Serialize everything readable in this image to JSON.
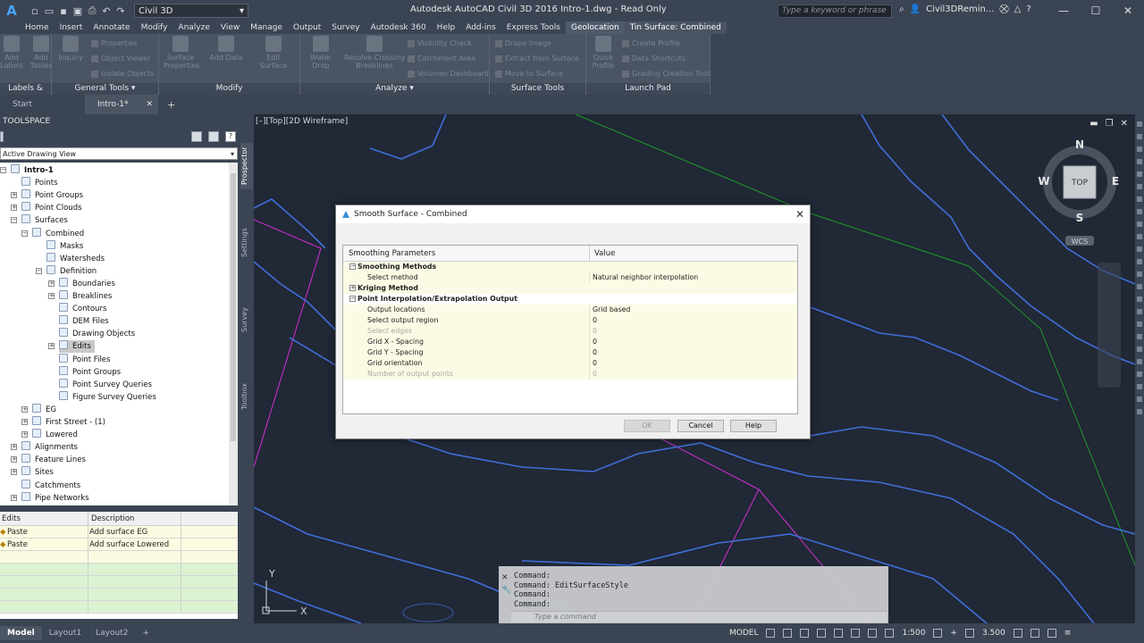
{
  "titlebar": {
    "app_logo": "A",
    "workspace": "Civil 3D",
    "title": "Autodesk AutoCAD Civil 3D 2016    Intro-1.dwg - Read Only",
    "search_placeholder": "Type a keyword or phrase",
    "user": "Civil3DRemin..."
  },
  "ribbon_tabs": [
    "Home",
    "Insert",
    "Annotate",
    "Modify",
    "Analyze",
    "View",
    "Manage",
    "Output",
    "Survey",
    "Autodesk 360",
    "Help",
    "Add-ins",
    "Express Tools",
    "Geolocation",
    "Tin Surface: Combined"
  ],
  "ribbon_groups": {
    "labels_tables": "Labels & Tables",
    "general_tools": "General Tools",
    "modify": "Modify",
    "analyze": "Analyze",
    "surface_tools": "Surface Tools",
    "launch_pad": "Launch Pad",
    "buttons": {
      "add_labels": "Add Labels",
      "add_tables": "Add Tables",
      "inquiry": "Inquiry",
      "properties": "Properties",
      "object_viewer": "Object Viewer",
      "isolate_objects": "Isolate Objects",
      "surface_properties": "Surface Properties",
      "add_data": "Add Data",
      "edit_surface": "Edit Surface",
      "water_drop": "Water Drop",
      "resolve_crossing": "Resolve Crossing Breaklines",
      "visibility_check": "Visibility Check",
      "catchment_area": "Catchment Area",
      "volumes_dashboard": "Volumes Dashboard",
      "drape_image": "Drape Image",
      "extract_from_surface": "Extract from Surface",
      "move_to_surface": "Move to Surface",
      "quick_profile": "Quick Profile",
      "create_profile": "Create Profile",
      "data_shortcuts": "Data Shortcuts",
      "grading_creation_tools": "Grading Creation Tools"
    }
  },
  "doc_tabs": {
    "start": "Start",
    "active": "Intro-1*"
  },
  "toolspace": {
    "title": "TOOLSPACE",
    "view": "Active Drawing View",
    "side_tabs": [
      "Prospector",
      "Settings",
      "Survey",
      "Toolbox"
    ],
    "tree": [
      "Intro-1",
      "Points",
      "Point Groups",
      "Point Clouds",
      "Surfaces",
      "Combined",
      "Masks",
      "Watersheds",
      "Definition",
      "Boundaries",
      "Breaklines",
      "Contours",
      "DEM Files",
      "Drawing Objects",
      "Edits",
      "Point Files",
      "Point Groups",
      "Point Survey Queries",
      "Figure Survey Queries",
      "EG",
      "First Street - (1)",
      "Lowered",
      "Alignments",
      "Feature Lines",
      "Sites",
      "Catchments",
      "Pipe Networks"
    ],
    "list_headers": {
      "c1": "Edits",
      "c2": "Description"
    },
    "list_rows": [
      {
        "edit": "Paste",
        "desc": "Add surface EG"
      },
      {
        "edit": "Paste",
        "desc": "Add surface Lowered"
      }
    ]
  },
  "viewport": {
    "label": "[–][Top][2D Wireframe]",
    "compass": {
      "n": "N",
      "s": "S",
      "e": "E",
      "w": "W",
      "top": "TOP",
      "wcs": "WCS"
    },
    "ucs_x": "X",
    "ucs_y": "Y"
  },
  "dialog": {
    "title": "Smooth Surface - Combined",
    "col_param": "Smoothing Parameters",
    "col_value": "Value",
    "rows": [
      {
        "name": "Smoothing Methods",
        "value": ""
      },
      {
        "name": "Select method",
        "value": "Natural neighbor interpolation"
      },
      {
        "name": "Kriging Method",
        "value": ""
      },
      {
        "name": "Point Interpolation/Extrapolation Output",
        "value": ""
      },
      {
        "name": "Output locations",
        "value": "Grid based"
      },
      {
        "name": "Select output region",
        "value": "0"
      },
      {
        "name": "Select edges",
        "value": "0"
      },
      {
        "name": "Grid X - Spacing",
        "value": "0"
      },
      {
        "name": "Grid Y - Spacing",
        "value": "0"
      },
      {
        "name": "Grid orientation",
        "value": "0"
      },
      {
        "name": "Number of output points",
        "value": "0"
      }
    ],
    "ok": "OK",
    "cancel": "Cancel",
    "help": "Help"
  },
  "command": {
    "history": [
      "Command:",
      "Command: EditSurfaceStyle",
      "Command:",
      "Command:"
    ],
    "placeholder": "Type a command"
  },
  "statusbar": {
    "tabs": [
      "Model",
      "Layout1",
      "Layout2"
    ],
    "model": "MODEL",
    "scale": "1:500",
    "value": "3.500"
  },
  "colors": {
    "accent": "#3a8fd8",
    "contour": "#3f6fd8",
    "magenta": "#d22fd2",
    "green": "#1f9a2a"
  }
}
